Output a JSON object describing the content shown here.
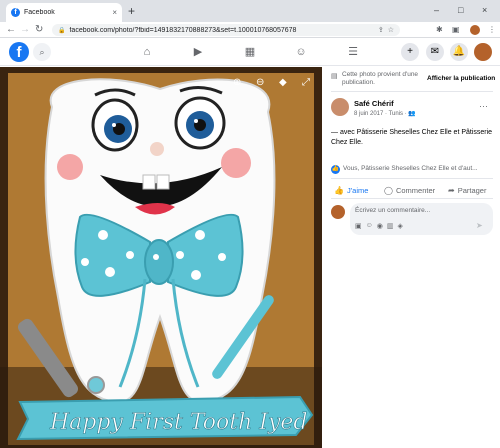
{
  "browser": {
    "tab_title": "Facebook",
    "tab_favicon": "f",
    "tab_close": "×",
    "new_tab": "+",
    "url": "facebook.com/photo/?fbid=1491832170888273&set=t.100010768057678",
    "min": "–",
    "max": "□",
    "close": "×"
  },
  "fb": {
    "logo": "f",
    "accent": "#1877f2"
  },
  "photo": {
    "banner_text": "Happy First Tooth Iyed",
    "cake_description_colors": {
      "tie": "#5cc3d4",
      "board": "#c48a3a",
      "tooth": "#ffffff"
    }
  },
  "panel": {
    "notice": "Cette photo provient d'une publication.",
    "show_post": "Afficher la publication",
    "author": "Safé Chérif",
    "meta": "8 juin 2017 · Tunis · ",
    "body": "— avec Pâtisserie Sheselles Chez Elle et Pâtisserie Chez Elle.",
    "reactions": "Vous, Pâtisserie Sheselles Chez Elle et d'aut...",
    "like": "J'aime",
    "comment": "Commenter",
    "share": "Partager",
    "comment_placeholder": "Écrivez un commentaire..."
  }
}
